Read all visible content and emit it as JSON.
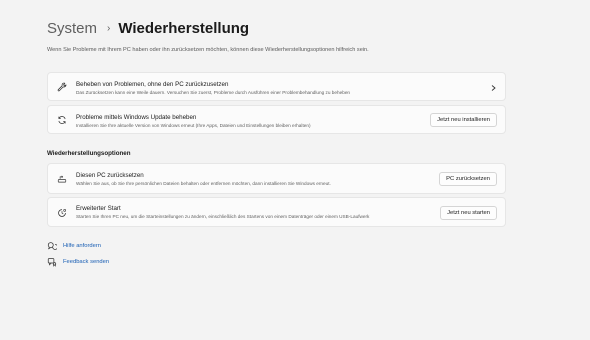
{
  "breadcrumb": {
    "parent": "System",
    "separator": "›",
    "current": "Wiederherstellung"
  },
  "intro_text": "Wenn Sie Probleme mit Ihrem PC haben oder ihn zurücksetzen möchten, können diese Wiederherstellungsoptionen hilfreich sein.",
  "cards": {
    "troubleshoot": {
      "icon": "wrench-icon",
      "title": "Beheben von Problemen, ohne den PC zurückzusetzen",
      "description": "Das Zurücksetzen kann eine Weile dauern. Versuchen Sie zuerst, Probleme durch Ausführen einer Problembehandlung zu beheben"
    },
    "windows_update": {
      "icon": "refresh-icon",
      "title": "Probleme mittels Windows Update beheben",
      "description": "Installieren Sie Ihre aktuelle Version von Windows erneut (Ihre Apps, Dateien und Einstellungen bleiben erhalten)",
      "button": "Jetzt neu installieren"
    }
  },
  "recovery_section": {
    "heading": "Wiederherstellungsoptionen",
    "reset": {
      "icon": "reset-pc-icon",
      "title": "Diesen PC zurücksetzen",
      "description": "Wählen Sie aus, ob Sie Ihre persönlichen Dateien behalten oder entfernen möchten, dann installieren Sie Windows erneut.",
      "button": "PC zurücksetzen"
    },
    "advanced_start": {
      "icon": "advanced-startup-icon",
      "title": "Erweiterter Start",
      "description": "Starten Sie Ihren PC neu, um die Starteinstellungen zu ändern, einschließlich des Startens von einem Datenträger oder einem USB-Laufwerk",
      "button": "Jetzt neu starten"
    }
  },
  "links": {
    "help": {
      "icon": "help-chat-icon",
      "label": "Hilfe anfordern"
    },
    "feedback": {
      "icon": "feedback-icon",
      "label": "Feedback senden"
    }
  },
  "colors": {
    "background": "#f3f3f3",
    "card": "#fbfbfb",
    "link": "#1a5fb4"
  }
}
